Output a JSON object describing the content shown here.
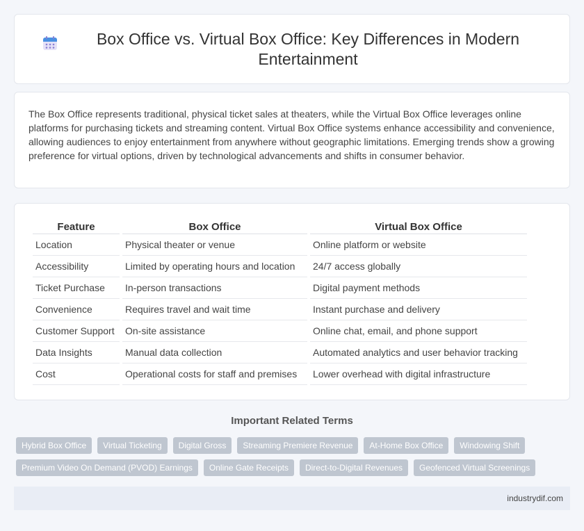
{
  "header": {
    "title": "Box Office vs. Virtual Box Office: Key Differences in Modern Entertainment",
    "icon": "calendar-icon"
  },
  "intro": {
    "text": "The Box Office represents traditional, physical ticket sales at theaters, while the Virtual Box Office leverages online platforms for purchasing tickets and streaming content. Virtual Box Office systems enhance accessibility and convenience, allowing audiences to enjoy entertainment from anywhere without geographic limitations. Emerging trends show a growing preference for virtual options, driven by technological advancements and shifts in consumer behavior."
  },
  "table": {
    "headers": [
      "Feature",
      "Box Office",
      "Virtual Box Office"
    ],
    "rows": [
      [
        "Location",
        "Physical theater or venue",
        "Online platform or website"
      ],
      [
        "Accessibility",
        "Limited by operating hours and location",
        "24/7 access globally"
      ],
      [
        "Ticket Purchase",
        "In-person transactions",
        "Digital payment methods"
      ],
      [
        "Convenience",
        "Requires travel and wait time",
        "Instant purchase and delivery"
      ],
      [
        "Customer Support",
        "On-site assistance",
        "Online chat, email, and phone support"
      ],
      [
        "Data Insights",
        "Manual data collection",
        "Automated analytics and user behavior tracking"
      ],
      [
        "Cost",
        "Operational costs for staff and premises",
        "Lower overhead with digital infrastructure"
      ]
    ]
  },
  "related": {
    "title": "Important Related Terms",
    "row1": [
      "Hybrid Box Office",
      "Virtual Ticketing",
      "Digital Gross",
      "Streaming Premiere Revenue",
      "At-Home Box Office",
      "Windowing Shift"
    ],
    "row2": [
      "Premium Video On Demand (PVOD) Earnings",
      "Online Gate Receipts",
      "Direct-to-Digital Revenues",
      "Geofenced Virtual Screenings"
    ]
  },
  "footer": {
    "text": "industrydif.com"
  },
  "colors": {
    "tag_bg": "#bfc6d0",
    "footer_bg": "#e9edf5",
    "icon_purple": "#8a7fd4"
  }
}
